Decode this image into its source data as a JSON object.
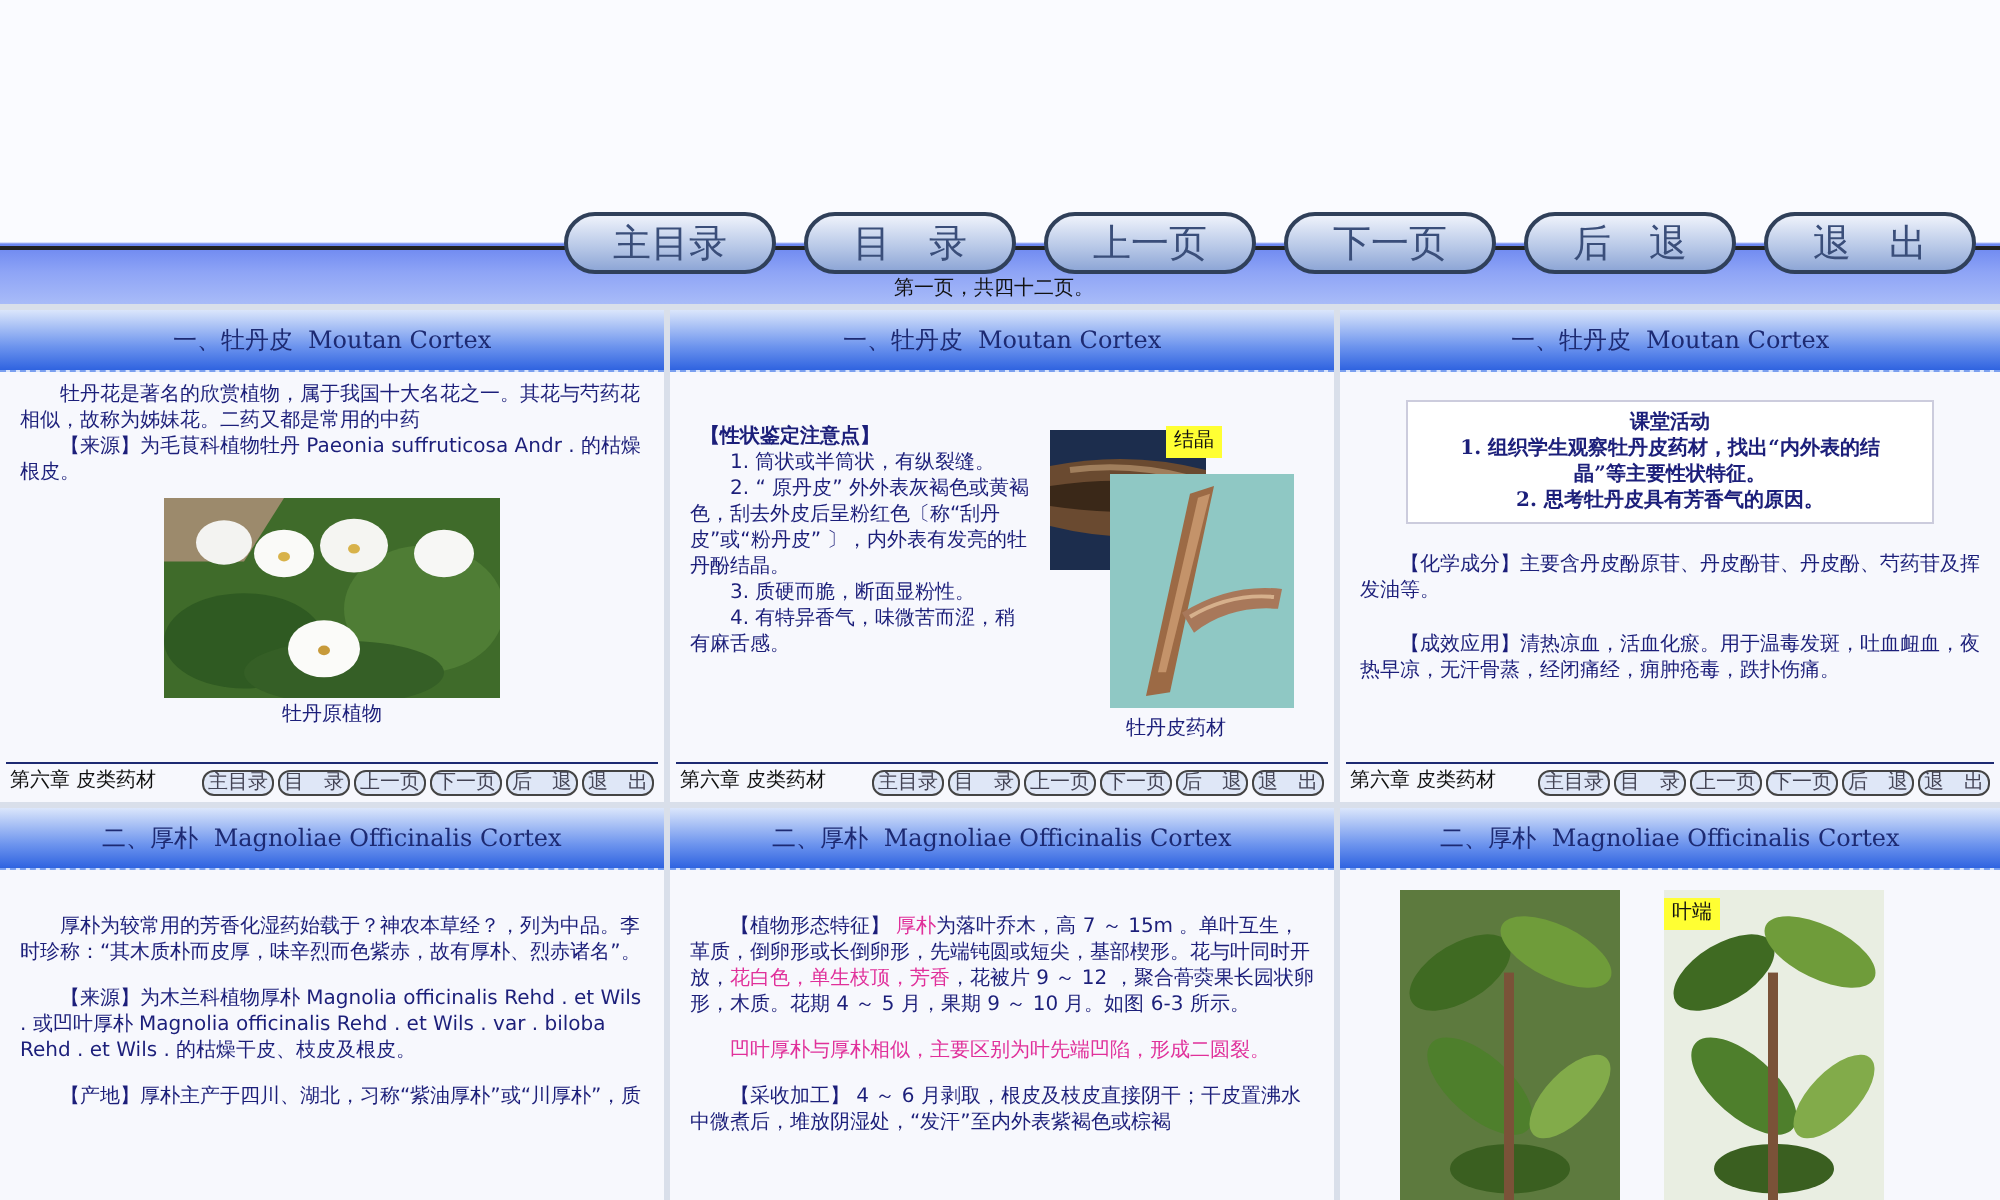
{
  "nav": {
    "buttons": [
      "主目录",
      "目　录",
      "上一页",
      "下一页",
      "后　退",
      "退　出"
    ],
    "page_info": "第一页，共四十二页。"
  },
  "slides": [
    {
      "kind": "photo-below",
      "title": "一、牡丹皮  Moutan Cortex",
      "paragraphs": [
        [
          {
            "text": "牡丹花是著名的欣赏植物，属于我国十大名花之一。其花与芍药花相似，故称为姊妹花。二药又都是常用的中药",
            "highlight": false
          }
        ],
        [
          {
            "text": "【来源】为毛茛科植物牡丹 Paeonia suffruticosa Andr . 的枯燥根皮。",
            "highlight": false
          }
        ]
      ],
      "figure": {
        "caption": "牡丹原植物"
      },
      "footer": {
        "chapter": "第六章 皮类药材",
        "buttons": [
          "主目录",
          "目　录",
          "上一页",
          "下一页",
          "后　退",
          "退　出"
        ]
      }
    },
    {
      "kind": "photo-side",
      "title": "一、牡丹皮  Moutan Cortex",
      "paragraphs": [
        [
          {
            "text": "【性状鉴定注意点】",
            "highlight": false
          }
        ],
        [
          {
            "text": "1. 筒状或半筒状，有纵裂缝。",
            "highlight": false
          }
        ],
        [
          {
            "text": "2. “ 原丹皮” 外外表灰褐色或黄褐色，刮去外皮后呈粉红色〔称“刮丹皮”或“粉丹皮” 〕，内外表有发亮的牡丹酚结晶。",
            "highlight": false
          }
        ],
        [
          {
            "text": "3. 质硬而脆，断面显粉性。",
            "highlight": false
          }
        ],
        [
          {
            "text": "4. 有特异香气，味微苦而涩，稍有麻舌感。",
            "highlight": false
          }
        ]
      ],
      "figure": {
        "callout": "结晶",
        "caption": "牡丹皮药材"
      },
      "footer": {
        "chapter": "第六章 皮类药材",
        "buttons": [
          "主目录",
          "目　录",
          "上一页",
          "下一页",
          "后　退",
          "退　出"
        ]
      }
    },
    {
      "kind": "activity",
      "title": "一、牡丹皮  Moutan Cortex",
      "box": {
        "heading": "课堂活动",
        "lines": [
          "1. 组织学生观察牡丹皮药材，找出“内外表的结晶”等主要性状特征。",
          "2. 思考牡丹皮具有芳香气的原因。"
        ]
      },
      "paragraphs": [
        [
          {
            "text": "【化学成分】主要含丹皮酚原苷、丹皮酚苷、丹皮酚、芍药苷及挥发油等。",
            "highlight": false
          }
        ],
        [
          {
            "text": "【成效应用】清热凉血，活血化瘀。用于温毒发斑，吐血衄血，夜热早凉，无汗骨蒸，经闭痛经，痈肿疮毒，跌扑伤痛。",
            "highlight": false
          }
        ]
      ],
      "footer": {
        "chapter": "第六章 皮类药材",
        "buttons": [
          "主目录",
          "目　录",
          "上一页",
          "下一页",
          "后　退",
          "退　出"
        ]
      }
    },
    {
      "kind": "text",
      "title": "二、厚朴  Magnoliae Officinalis Cortex",
      "paragraphs": [
        [
          {
            "text": "厚朴为较常用的芳香化湿药始载于？神农本草经？，列为中品。李时珍称：“其木质朴而皮厚，味辛烈而色紫赤，故有厚朴、烈赤诸名”。",
            "highlight": false
          }
        ],
        [
          {
            "text": "【来源】为木兰科植物厚朴 Magnolia officinalis Rehd . et Wils . 或凹叶厚朴 Magnolia officinalis Rehd . et Wils . var . biloba Rehd . et Wils . 的枯燥干皮、枝皮及根皮。",
            "highlight": false
          }
        ],
        [
          {
            "text": "【产地】厚朴主产于四川、湖北，习称“紫油厚朴”或“川厚朴”，质",
            "highlight": false
          }
        ]
      ]
    },
    {
      "kind": "text",
      "title": "二、厚朴  Magnoliae Officinalis Cortex",
      "paragraphs": [
        [
          {
            "text": "【植物形态特征】 ",
            "highlight": false
          },
          {
            "text": "厚朴",
            "highlight": true
          },
          {
            "text": "为落叶乔木，高 7 ～ 15m 。单叶互生，革质，倒卵形或长倒卵形，先端钝圆或短尖，基部楔形。花与叶同时开放，",
            "highlight": false
          },
          {
            "text": "花白色，单生枝顶，芳香",
            "highlight": true
          },
          {
            "text": "，花被片 9 ～ 12 ，聚合蓇葖果长园状卵形，木质。花期 4 ～ 5 月，果期 9 ～ 10 月。如图 6-3 所示。",
            "highlight": false
          }
        ],
        [
          {
            "text": "凹叶厚朴与厚朴相似，主要区别为叶先端凹陷，形成二圆裂。",
            "highlight": true
          }
        ],
        [
          {
            "text": "【采收加工】 4 ～ 6 月剥取，根皮及枝皮直接阴干；干皮置沸水中微煮后，堆放阴湿处，“发汗”至内外表紫褐色或棕褐",
            "highlight": false
          }
        ]
      ]
    },
    {
      "kind": "photo-pair",
      "title": "二、厚朴  Magnoliae Officinalis Cortex",
      "figure": {
        "callout": "叶端"
      }
    }
  ]
}
